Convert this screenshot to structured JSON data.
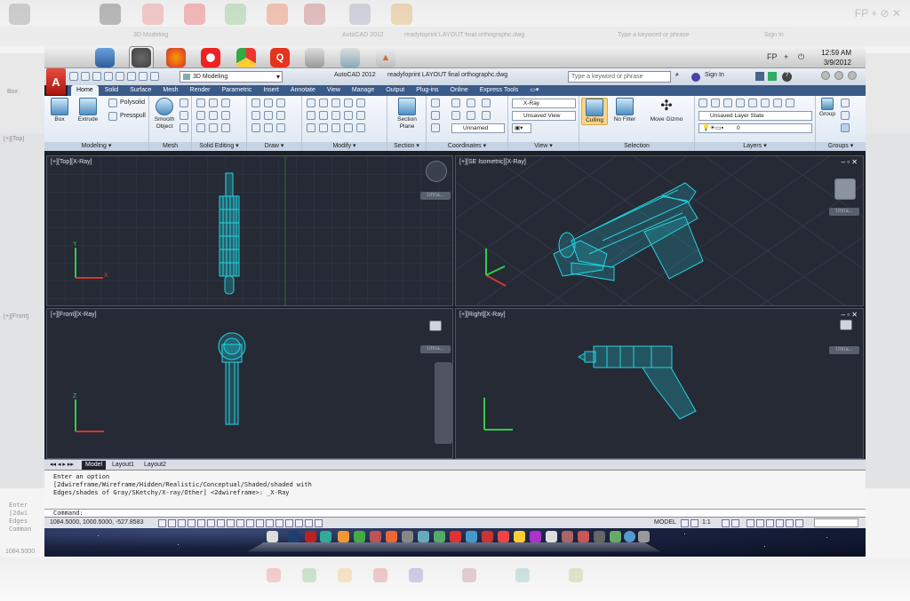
{
  "desktop": {
    "bg_menu": "Box",
    "bg_tab": "3D Modeling",
    "bg_title_app": "AutoCAD 2012",
    "bg_title_file": "readytoprint LAYOUT final orthographc.dwg",
    "bg_search": "Type a keyword or phrase",
    "bg_signin": "Sign In",
    "bg_label1": "[+][Top]",
    "bg_label2": "[+][Front]",
    "bg_cmd1": "Enter",
    "bg_cmd2": "[2dwi",
    "bg_cmd3": "Edges",
    "bg_cmd4": "Comman",
    "bg_status": "1084.5000"
  },
  "menubar": {
    "tray_fp": "FP",
    "tray_plus": "+",
    "time": "12:59 AM",
    "date": "3/9/2012"
  },
  "autocad": {
    "logo": "A",
    "workspace": "3D Modeling",
    "app_name": "AutoCAD 2012",
    "file_name": "readyfoprint LAYOUT final orthographc.dwg",
    "search_placeholder": "Type a keyword or phrase",
    "sign_in": "Sign In",
    "help": "?"
  },
  "tabs": [
    "Home",
    "Solid",
    "Surface",
    "Mesh",
    "Render",
    "Parametric",
    "Insert",
    "Annotate",
    "View",
    "Manage",
    "Output",
    "Plug-ins",
    "Online",
    "Express Tools"
  ],
  "ribbon": {
    "modeling": {
      "label": "Modeling",
      "box": "Box",
      "extrude": "Extrude",
      "polysolid": "Polysolid",
      "presspull": "Presspull"
    },
    "mesh": {
      "label": "Mesh",
      "smooth": "Smooth",
      "object": "Object"
    },
    "solid_editing": {
      "label": "Solid Editing"
    },
    "draw": {
      "label": "Draw"
    },
    "modify": {
      "label": "Modify"
    },
    "section": {
      "label": "Section",
      "plane1": "Section",
      "plane2": "Plane"
    },
    "coordinates": {
      "label": "Coordinates",
      "unnamed": "Unnamed"
    },
    "view": {
      "label": "View",
      "xray": "X-Ray",
      "unsaved": "Unsaved View"
    },
    "selection": {
      "label": "Selection",
      "culling": "Culling",
      "nofilter": "No Filter",
      "movegizmo": "Move Gizmo"
    },
    "layers": {
      "label": "Layers",
      "state": "Unsaved Layer State",
      "zero": "0"
    },
    "groups": {
      "label": "Groups",
      "group": "Group"
    }
  },
  "viewports": [
    {
      "label": "[+][Top][X-Ray]",
      "unnamed": "Unna..."
    },
    {
      "label": "[+][SE Isometric][X-Ray]",
      "unnamed": "Unna..."
    },
    {
      "label": "[+][Front][X-Ray]",
      "unnamed": "Unna..."
    },
    {
      "label": "[+][Right][X-Ray]",
      "unnamed": "Unna..."
    }
  ],
  "axis": {
    "x": "X",
    "y": "Y",
    "z": "Z"
  },
  "layout_tabs": [
    "Model",
    "Layout1",
    "Layout2"
  ],
  "command": {
    "line1": "Enter an option",
    "line2": "[2dwireframe/Wireframe/Hidden/Realistic/Conceptual/Shaded/shaded with",
    "line3": "Edges/shades of Gray/SKetchy/X-ray/Other] <2dwireframe>: _X-Ray",
    "prompt": "Command:"
  },
  "status": {
    "coords": "1084.5000, 1000.5000, -527.8583",
    "model": "MODEL",
    "scale": "1:1"
  },
  "colors": {
    "accent": "#3a5a88",
    "wire": "#25d3e0",
    "viewport_bg": "#252a35",
    "autocad_red": "#d0281c"
  }
}
